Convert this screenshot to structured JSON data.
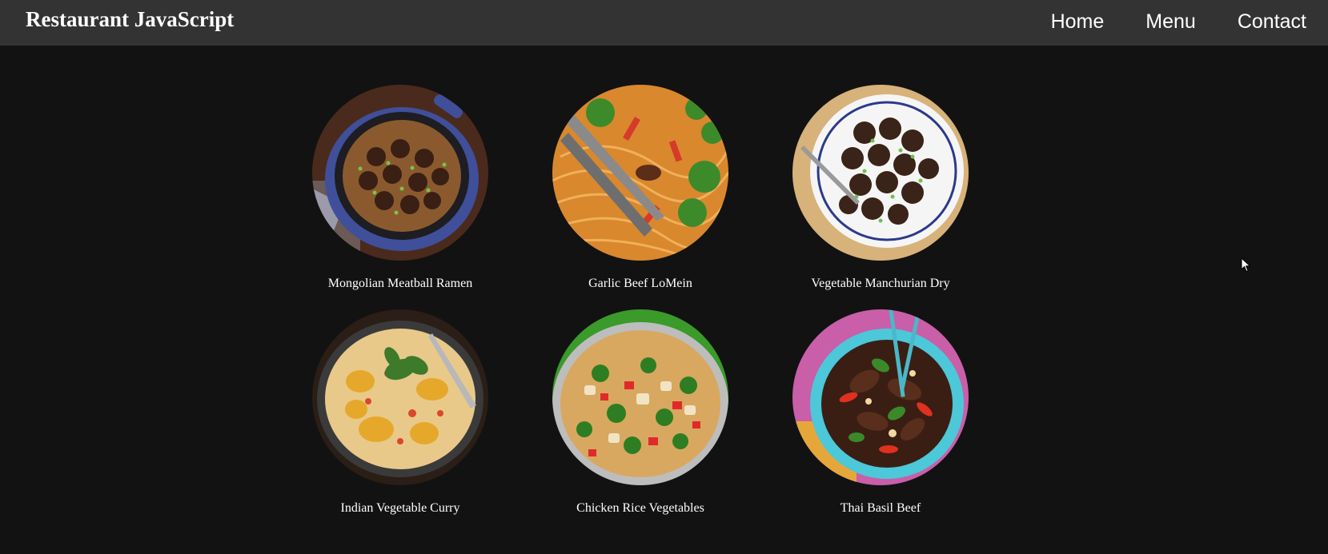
{
  "navbar": {
    "brand": "Restaurant JavaScript",
    "links": [
      {
        "label": "Home"
      },
      {
        "label": "Menu"
      },
      {
        "label": "Contact"
      }
    ]
  },
  "menu": {
    "items": [
      {
        "name": "Mongolian Meatball Ramen"
      },
      {
        "name": "Garlic Beef LoMein"
      },
      {
        "name": "Vegetable Manchurian Dry"
      },
      {
        "name": "Indian Vegetable Curry"
      },
      {
        "name": "Chicken Rice Vegetables"
      },
      {
        "name": "Thai Basil Beef"
      }
    ]
  },
  "colors": {
    "page_background": "#121212",
    "navbar_background": "#333333",
    "text": "#ffffff"
  }
}
